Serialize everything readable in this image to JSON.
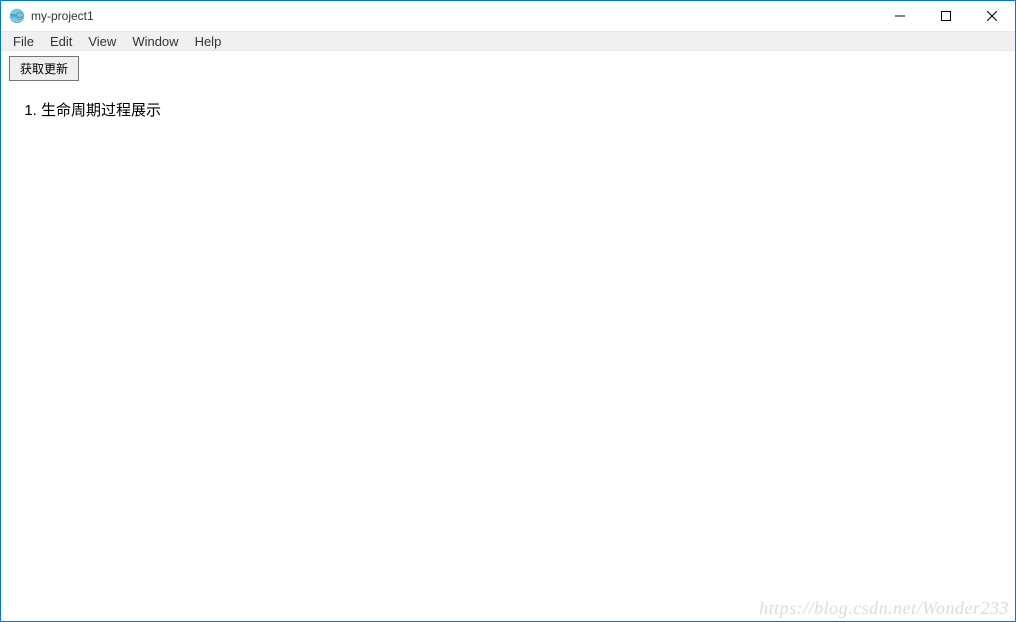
{
  "window": {
    "title": "my-project1"
  },
  "menu": {
    "items": [
      "File",
      "Edit",
      "View",
      "Window",
      "Help"
    ]
  },
  "toolbar": {
    "update_button_label": "获取更新"
  },
  "content": {
    "list_items": [
      "生命周期过程展示"
    ]
  },
  "watermark": "https://blog.csdn.net/Wonder233"
}
